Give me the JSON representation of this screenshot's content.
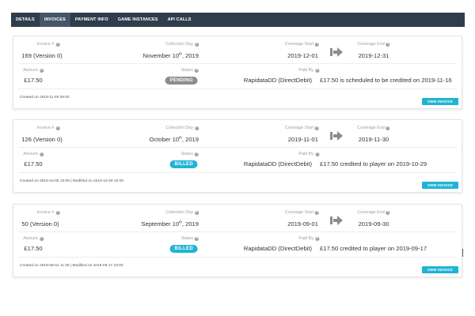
{
  "tabs": [
    {
      "label": "DETAILS"
    },
    {
      "label": "INVOICES"
    },
    {
      "label": "PAYMENT INFO"
    },
    {
      "label": "GAME INSTANCES"
    },
    {
      "label": "API CALLS"
    }
  ],
  "labels": {
    "invoice": "Invoice #",
    "collection_day": "Collection Day",
    "coverage_start": "Coverage Start",
    "coverage_end": "Coverage End",
    "amount": "Amount",
    "status": "Status",
    "paid_by": "Paid By",
    "view_invoice": "VIEW INVOICE",
    "help_glyph": "?"
  },
  "invoices": [
    {
      "invoice_number": "169 (Version 0)",
      "collection_day": {
        "prefix": "November 10",
        "suffix": "th",
        "year": ", 2019"
      },
      "coverage_start": "2019-12-01",
      "coverage_end": "2019-12-31",
      "amount": "£17.50",
      "status": "PENDING",
      "paid_by": "RapidataDD (DirectDebit)",
      "note": "£17.50 is scheduled to be credited on 2019-11-16",
      "created": "Created on 2019-11-05 09:00"
    },
    {
      "invoice_number": "126 (Version 0)",
      "collection_day": {
        "prefix": "October 10",
        "suffix": "th",
        "year": ", 2019"
      },
      "coverage_start": "2019-11-01",
      "coverage_end": "2019-11-30",
      "amount": "£17.50",
      "status": "BILLED",
      "paid_by": "RapidataDD (DirectDebit)",
      "note": "£17.50 credited to player on 2019-10-29",
      "created": "Created on 2019-10-05 10:00 | Modified on 2019-10-29 10:00"
    },
    {
      "invoice_number": "50 (Version 0)",
      "collection_day": {
        "prefix": "September 10",
        "suffix": "th",
        "year": ", 2019"
      },
      "coverage_start": "2019-09-01",
      "coverage_end": "2019-09-30",
      "amount": "£17.50",
      "status": "BILLED",
      "paid_by": "RapidataDD (DirectDebit)",
      "note": "£17.50 credited to player on 2019-09-17",
      "created": "Created on 2019-08-01 11:45 | Modified on 2019-09-17 10:00"
    }
  ],
  "colors": {
    "nav_bg": "#2f3d4c",
    "nav_active": "#45556a",
    "accent": "#20b4d4",
    "pending": "#8c8c8c"
  },
  "icons": {
    "arrow": "arrow-right-icon",
    "help": "help-icon"
  }
}
